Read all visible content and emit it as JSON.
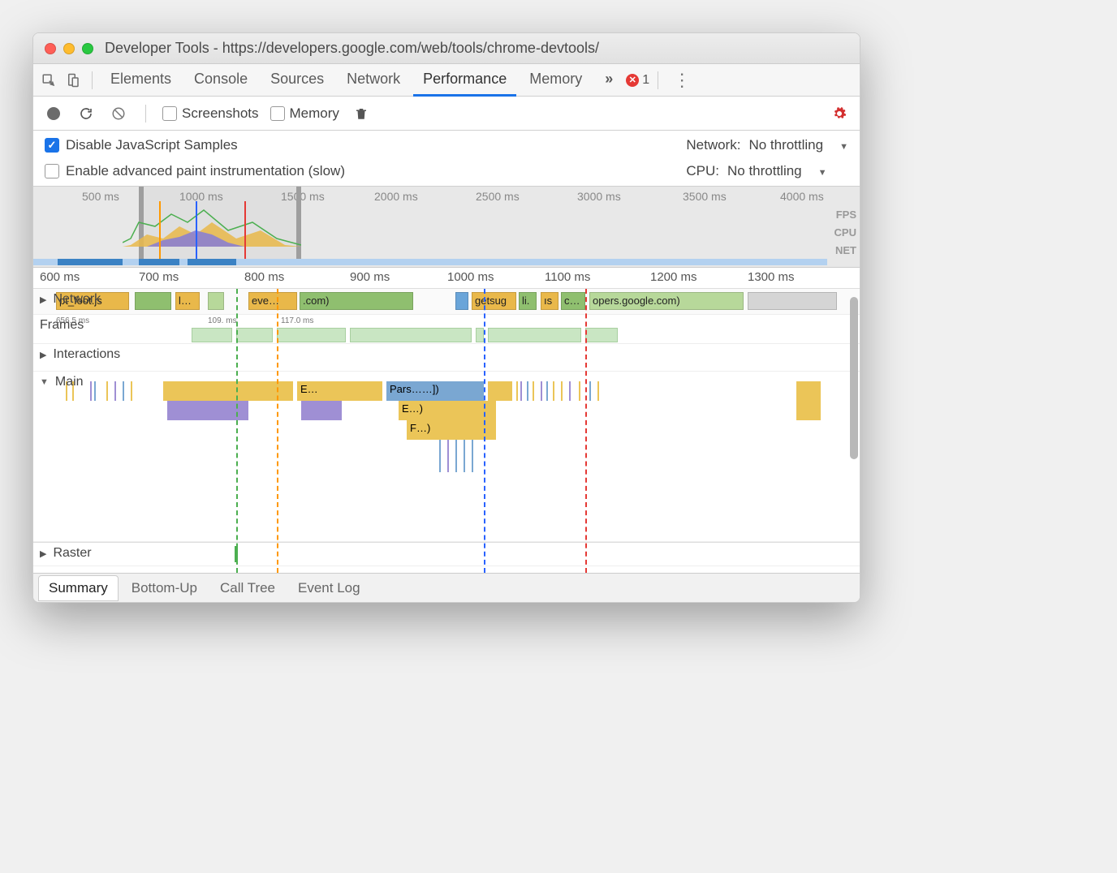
{
  "window": {
    "title": "Developer Tools - https://developers.google.com/web/tools/chrome-devtools/"
  },
  "tabs": {
    "items": [
      "Elements",
      "Console",
      "Sources",
      "Network",
      "Performance",
      "Memory"
    ],
    "active": "Performance",
    "overflow": "»",
    "error_count": "1"
  },
  "toolbar": {
    "screenshots": "Screenshots",
    "memory": "Memory"
  },
  "settings": {
    "disable_js": "Disable JavaScript Samples",
    "enable_paint": "Enable advanced paint instrumentation (slow)",
    "network_label": "Network:",
    "network_value": "No throttling",
    "cpu_label": "CPU:",
    "cpu_value": "No throttling"
  },
  "overview": {
    "ticks": [
      "500 ms",
      "1000 ms",
      "1500 ms",
      "2000 ms",
      "2500 ms",
      "3000 ms",
      "3500 ms",
      "4000 ms"
    ],
    "lanes": [
      "FPS",
      "CPU",
      "NET"
    ]
  },
  "ruler": {
    "ticks": [
      "600 ms",
      "700 ms",
      "800 ms",
      "900 ms",
      "1000 ms",
      "1100 ms",
      "1200 ms",
      "1300 ms"
    ]
  },
  "tracks": {
    "network": "Network",
    "frames": "Frames",
    "interactions": "Interactions",
    "main": "Main",
    "raster": "Raster",
    "network_segments": {
      "s0": "pt_foot.js",
      "s1": "l…",
      "s2": "eve…",
      "s3": ".com)",
      "s4": "getsug",
      "s5": "li.",
      "s6": "ıs",
      "s7": "c…",
      "s8": "opers.google.com)"
    },
    "frame_times": {
      "t0": "656.5 ms",
      "t1": "109.  ms",
      "t2": "117.0 ms"
    },
    "flame": {
      "e": "E…",
      "pars": "Pars……])",
      "e2": "E…)",
      "f": "F…)"
    }
  },
  "bottom_tabs": {
    "items": [
      "Summary",
      "Bottom-Up",
      "Call Tree",
      "Event Log"
    ],
    "active": "Summary"
  }
}
